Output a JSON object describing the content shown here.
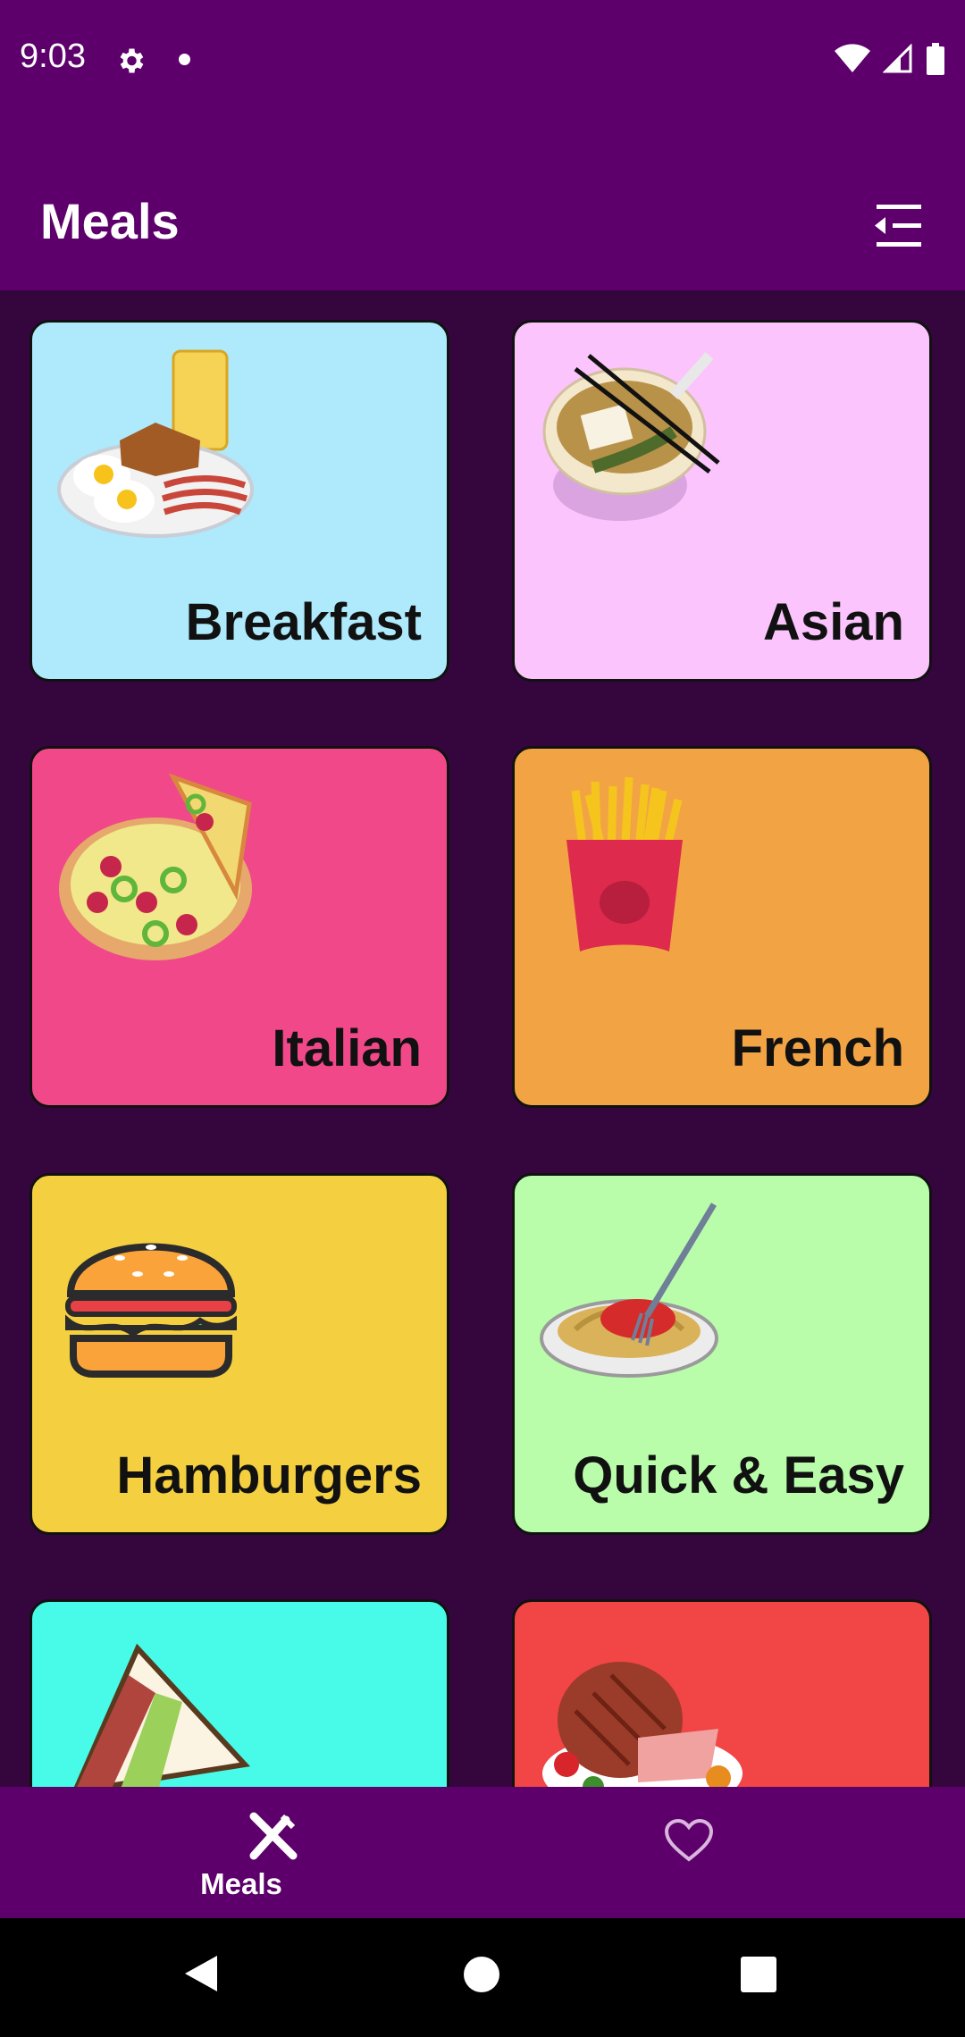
{
  "status": {
    "time": "9:03"
  },
  "appbar": {
    "title": "Meals"
  },
  "categories": [
    {
      "label": "Breakfast",
      "color": "#aee9fc"
    },
    {
      "label": "Asian",
      "color": "#fbc4fd"
    },
    {
      "label": "Italian",
      "color": "#f1488a"
    },
    {
      "label": "French",
      "color": "#f2a444"
    },
    {
      "label": "Hamburgers",
      "color": "#f4cf40"
    },
    {
      "label": "Quick & Easy",
      "color": "#b9fdab"
    },
    {
      "label": "",
      "color": "#48fbe9"
    },
    {
      "label": "",
      "color": "#f14546"
    }
  ],
  "bottom_nav": {
    "meals_label": "Meals"
  }
}
